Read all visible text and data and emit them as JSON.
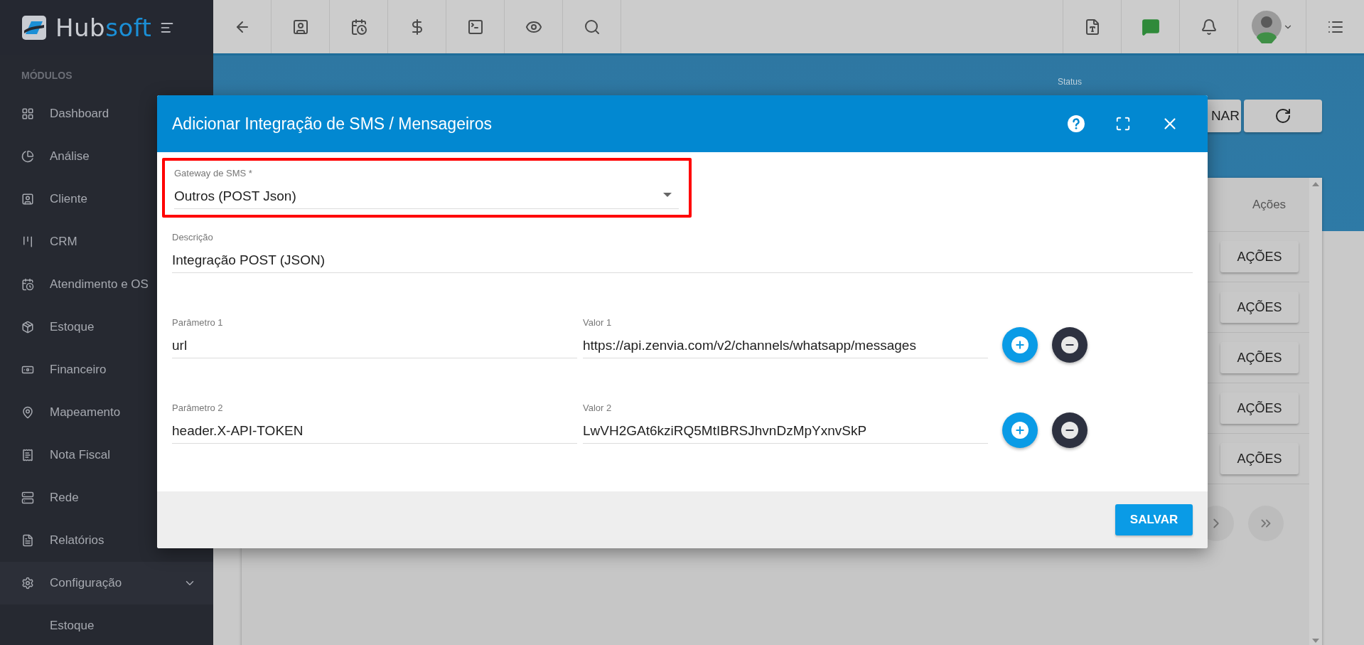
{
  "logo": {
    "parts": [
      "Hub",
      "soft"
    ]
  },
  "sidebar": {
    "heading": "MÓDULOS",
    "items": [
      {
        "label": "Dashboard"
      },
      {
        "label": "Análise"
      },
      {
        "label": "Cliente"
      },
      {
        "label": "CRM"
      },
      {
        "label": "Atendimento e OS"
      },
      {
        "label": "Estoque"
      },
      {
        "label": "Financeiro"
      },
      {
        "label": "Mapeamento"
      },
      {
        "label": "Nota Fiscal"
      },
      {
        "label": "Rede"
      },
      {
        "label": "Relatórios"
      },
      {
        "label": "Configuração",
        "expanded": true,
        "children": [
          {
            "label": "Estoque"
          }
        ]
      }
    ]
  },
  "background": {
    "status_label": "Status",
    "partial_button": "NAR",
    "table": {
      "columns": [
        "Ações"
      ],
      "rows": [
        {
          "action": "AÇÕES"
        },
        {
          "action": "AÇÕES"
        },
        {
          "action": "AÇÕES"
        },
        {
          "action": "AÇÕES"
        },
        {
          "action": "AÇÕES"
        }
      ]
    }
  },
  "dialog": {
    "title": "Adicionar Integração de SMS / Mensageiros",
    "gateway": {
      "label": "Gateway de SMS *",
      "value": "Outros (POST Json)",
      "highlighted": true
    },
    "description": {
      "label": "Descrição",
      "value": "Integração POST (JSON)"
    },
    "parameters": [
      {
        "name_label": "Parâmetro 1",
        "name": "url",
        "value_label": "Valor 1",
        "value": "https://api.zenvia.com/v2/channels/whatsapp/messages"
      },
      {
        "name_label": "Parâmetro 2",
        "name": "header.X-API-TOKEN",
        "value_label": "Valor 2",
        "value": "LwVH2GAt6kziRQ5MtIBRSJhvnDzMpYxnvSkP"
      }
    ],
    "save_button": "SALVAR"
  }
}
